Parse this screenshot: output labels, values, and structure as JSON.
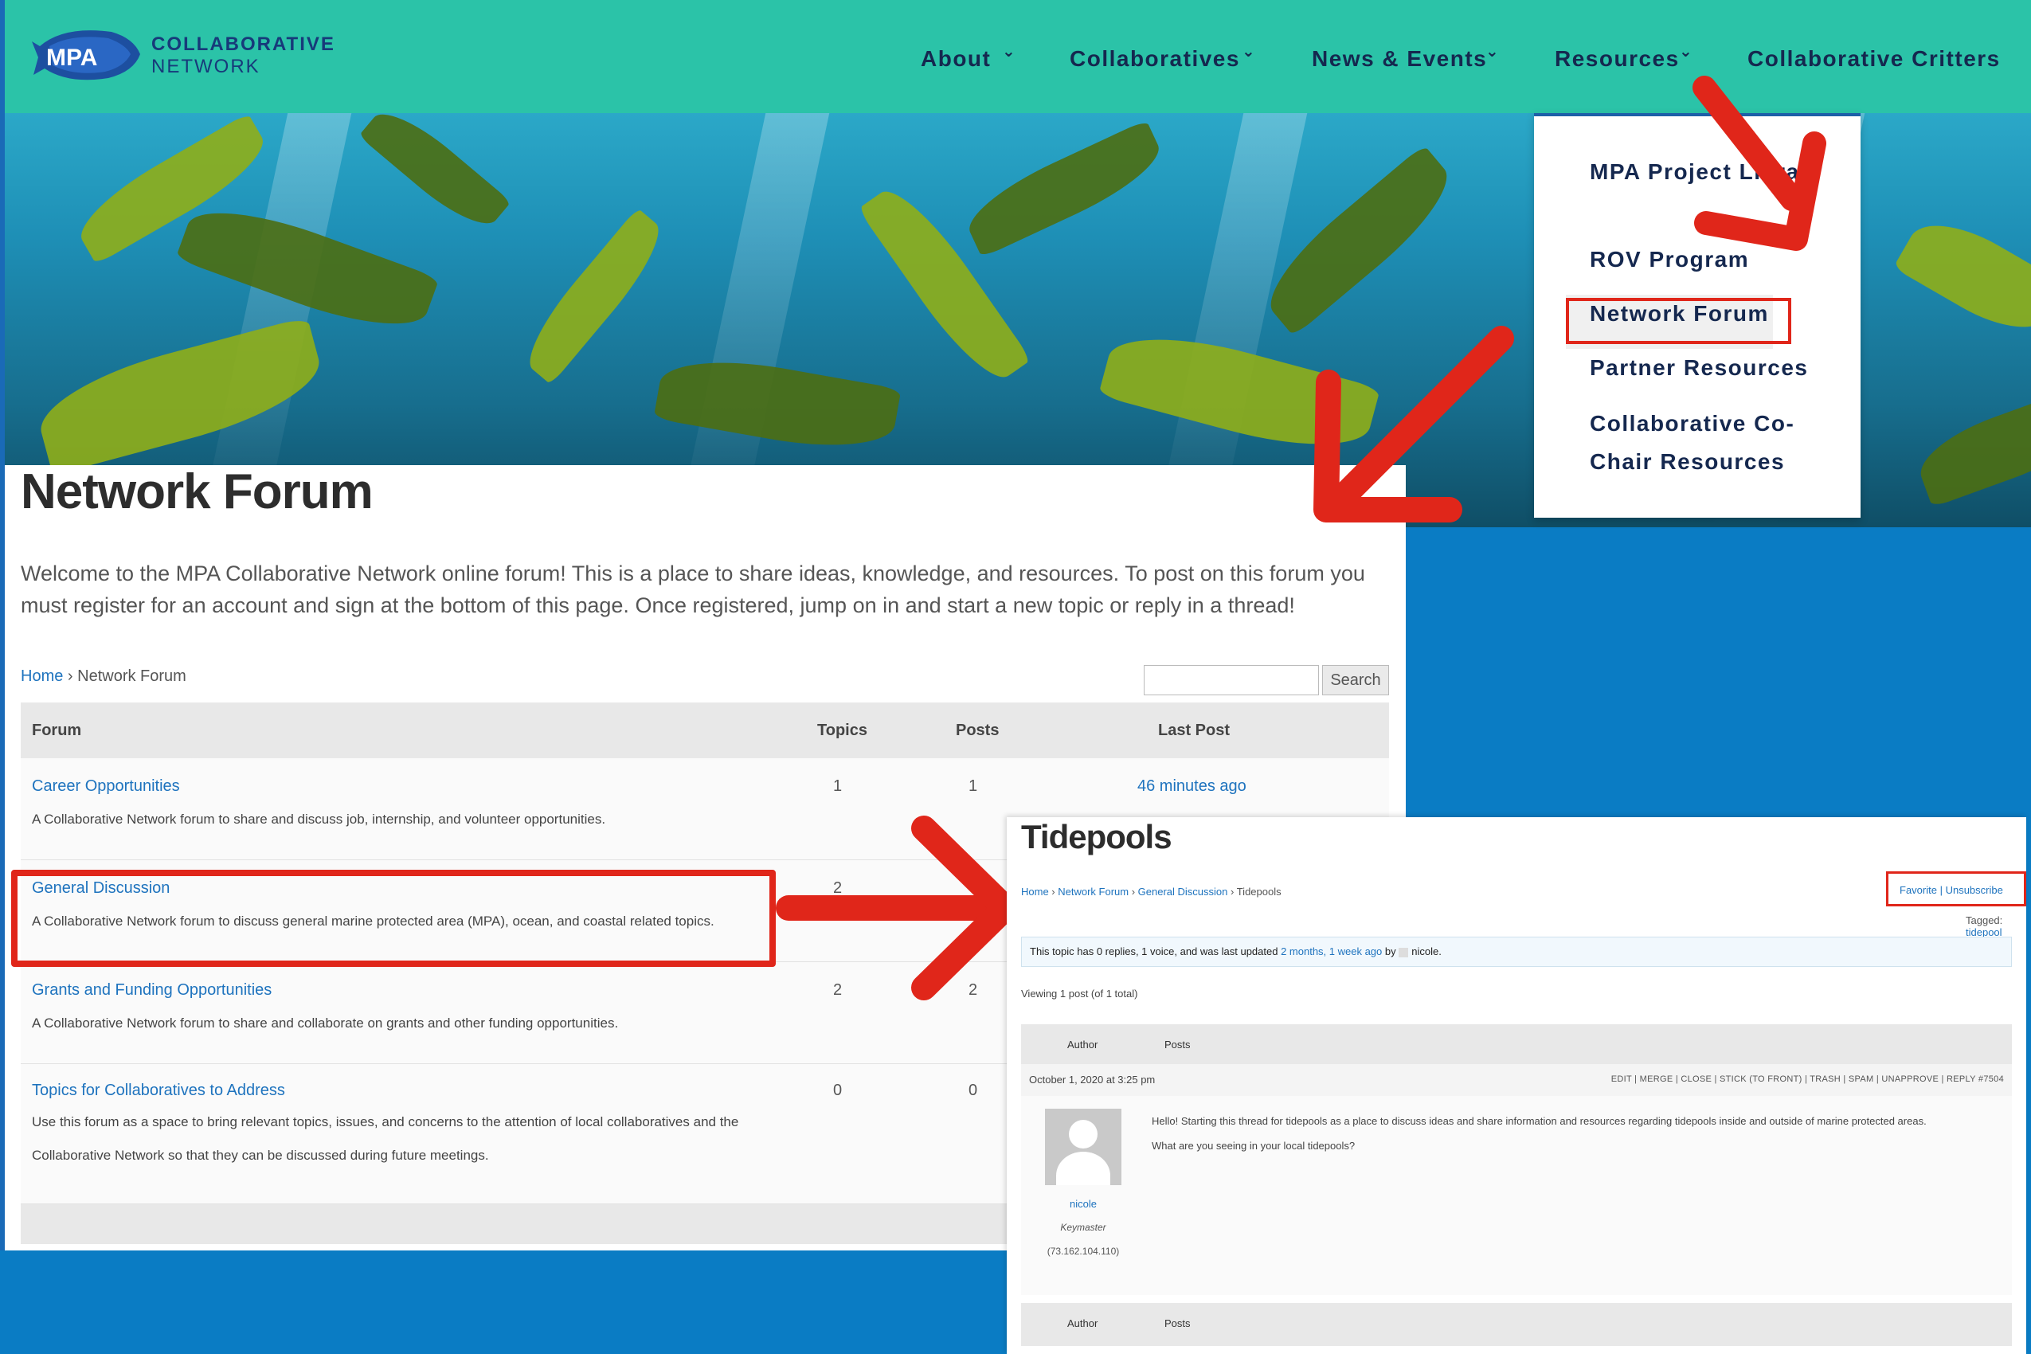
{
  "brand": {
    "logo_text": "MPA",
    "title": "COLLABORATIVE",
    "subtitle": "NETWORK"
  },
  "nav": {
    "items": [
      "About",
      "Collaboratives",
      "News & Events",
      "Resources",
      "Collaborative Critters"
    ]
  },
  "dropdown": {
    "items": [
      "MPA Project Library",
      "ROV Program",
      "Network Forum",
      "Partner Resources",
      "Collaborative Co-Chair Resources"
    ],
    "highlighted": "Network Forum"
  },
  "page": {
    "title": "Network Forum",
    "intro": "Welcome to the MPA Collaborative Network online forum! This is a place to share ideas, knowledge, and resources. To post on this forum you must register for an account and sign at the bottom of this page. Once registered, jump on in and start a new topic or reply in a thread!",
    "breadcrumb_home": "Home",
    "breadcrumb_sep": " › ",
    "breadcrumb_current": "Network Forum",
    "search_button": "Search",
    "search_value": ""
  },
  "forum_table": {
    "headers": {
      "forum": "Forum",
      "topics": "Topics",
      "posts": "Posts",
      "last_post": "Last Post"
    },
    "rows": [
      {
        "title": "Career Opportunities",
        "desc": "A Collaborative Network forum to share and discuss job, internship, and volunteer opportunities.",
        "topics": "1",
        "posts": "1",
        "last_post": "46 minutes ago"
      },
      {
        "title": "General Discussion",
        "desc": "A Collaborative Network forum to discuss general marine protected area (MPA), ocean, and coastal related topics.",
        "topics": "2",
        "posts": "",
        "last_post": ""
      },
      {
        "title": "Grants and Funding Opportunities",
        "desc": "A Collaborative Network forum to share and collaborate on grants and other funding opportunities.",
        "topics": "2",
        "posts": "2",
        "last_post": ""
      },
      {
        "title": "Topics for Collaboratives to Address",
        "desc": "Use this forum as a space to bring relevant topics, issues, and concerns to the attention of local collaboratives and the Collaborative Network so that they can be discussed during future meetings.",
        "topics": "0",
        "posts": "0",
        "last_post": ""
      }
    ]
  },
  "tidepools": {
    "title": "Tidepools",
    "crumbs": [
      "Home",
      "Network Forum",
      "General Discussion"
    ],
    "crumb_current": "Tidepools",
    "favorite": "Favorite",
    "link_sep": " | ",
    "unsubscribe": "Unsubscribe",
    "tagged_label": "Tagged: ",
    "tag": "tidepool",
    "notice_pre": "This topic has 0 replies, 1 voice, and was last updated ",
    "notice_link": "2 months, 1 week ago",
    "notice_by": " by ",
    "notice_user": "nicole",
    "viewing": "Viewing 1 post (of 1 total)",
    "col_author": "Author",
    "col_posts": "Posts",
    "post_date": "October 1, 2020 at 3:25 pm",
    "actions": "EDIT | MERGE | CLOSE | STICK (TO FRONT) | TRASH | SPAM | UNAPPROVE | REPLY   #7504",
    "author_name": "nicole",
    "author_role": "Keymaster",
    "author_ip": "(73.162.104.110)",
    "post_line1": "Hello! Starting this thread for tidepools as a place to discuss ideas and share information and resources regarding tidepools inside and outside of marine protected areas.",
    "post_line2": "What are you seeing in your local tidepools?"
  },
  "colors": {
    "header": "#2bc3a8",
    "nav_text": "#15284f",
    "link": "#1e73be",
    "annotation_red": "#e0261a",
    "page_bg": "#0a7cc4"
  },
  "icons": [
    "chevron-down-icon",
    "fish-logo-icon",
    "red-arrow-icon",
    "avatar-placeholder-icon"
  ]
}
